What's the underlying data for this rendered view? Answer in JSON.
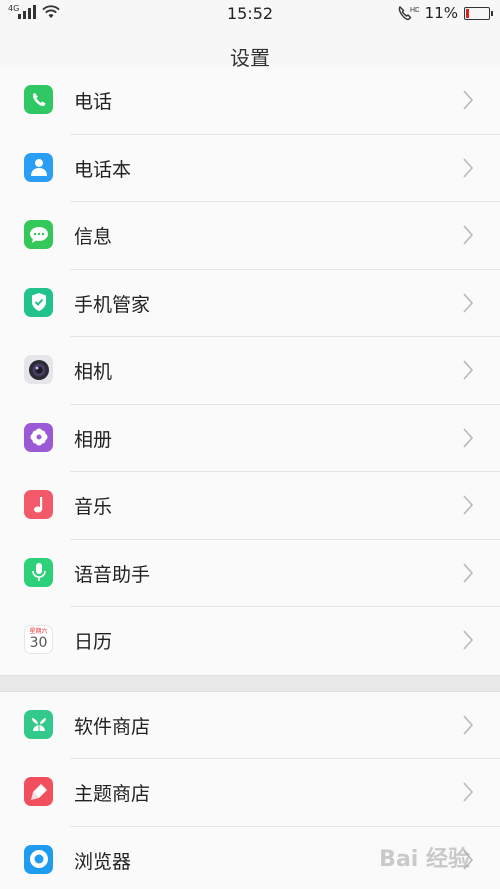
{
  "status_bar": {
    "network": "4G",
    "time": "15:52",
    "battery_percent": "11%",
    "battery_level": 0.11,
    "battery_color": "#e02020"
  },
  "header": {
    "title": "设置"
  },
  "section1": [
    {
      "label": "电话",
      "icon": "phone-icon",
      "color": "#2fc864"
    },
    {
      "label": "电话本",
      "icon": "contacts-icon",
      "color": "#2a9df4"
    },
    {
      "label": "信息",
      "icon": "messages-icon",
      "color": "#34c759"
    },
    {
      "label": "手机管家",
      "icon": "phone-manager-icon",
      "color": "#21c28b"
    },
    {
      "label": "相机",
      "icon": "camera-icon",
      "color": "#e6e6ea"
    },
    {
      "label": "相册",
      "icon": "photos-icon",
      "color": "#9b59d6"
    },
    {
      "label": "音乐",
      "icon": "music-icon",
      "color": "#f25a6a"
    },
    {
      "label": "语音助手",
      "icon": "voice-assistant-icon",
      "color": "#2fd07a"
    },
    {
      "label": "日历",
      "icon": "calendar-icon",
      "color": "#ffffff",
      "day": "30",
      "weekday": "星期六"
    }
  ],
  "section2": [
    {
      "label": "软件商店",
      "icon": "app-store-icon",
      "color": "#33c98b"
    },
    {
      "label": "主题商店",
      "icon": "theme-store-icon",
      "color": "#f14e5e"
    },
    {
      "label": "浏览器",
      "icon": "browser-icon",
      "color": "#1f9bf0"
    }
  ],
  "watermark": "Bai 经验"
}
